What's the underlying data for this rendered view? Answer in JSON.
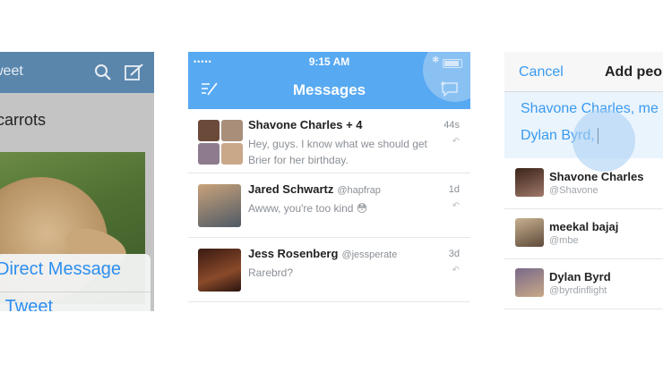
{
  "left_screen": {
    "nav_title": "weet",
    "tweet_text": "carrots",
    "action_sheet": {
      "item1": "Direct Message",
      "item2": "l Tweet"
    }
  },
  "messages_screen": {
    "status": {
      "signal": "•••••",
      "time": "9:15 AM"
    },
    "title": "Messages",
    "conversations": [
      {
        "name": "Shavone Charles + 4",
        "handle": "",
        "text": "Hey, guys. I know what we should get Brier for her birthday.",
        "ago": "44s"
      },
      {
        "name": "Jared Schwartz",
        "handle": "@hapfrap",
        "text": "Awww, you're too kind 😳",
        "ago": "1d"
      },
      {
        "name": "Jess Rosenberg",
        "handle": "@jessperate",
        "text": "Rarebrd?",
        "ago": "3d"
      }
    ]
  },
  "add_people_screen": {
    "cancel": "Cancel",
    "title": "Add peo",
    "recipients_line1": "Shavone Charles, me",
    "recipients_line2": "Dylan Byrd,",
    "people": [
      {
        "name": "Shavone Charles",
        "handle": "@Shavone"
      },
      {
        "name": "meekal bajaj",
        "handle": "@mbe"
      },
      {
        "name": "Dylan Byrd",
        "handle": "@byrdinflight"
      }
    ]
  },
  "colors": {
    "twitter_blue": "#57a9f2",
    "link_blue": "#3a9af0",
    "left_nav": "#5a86ac"
  }
}
